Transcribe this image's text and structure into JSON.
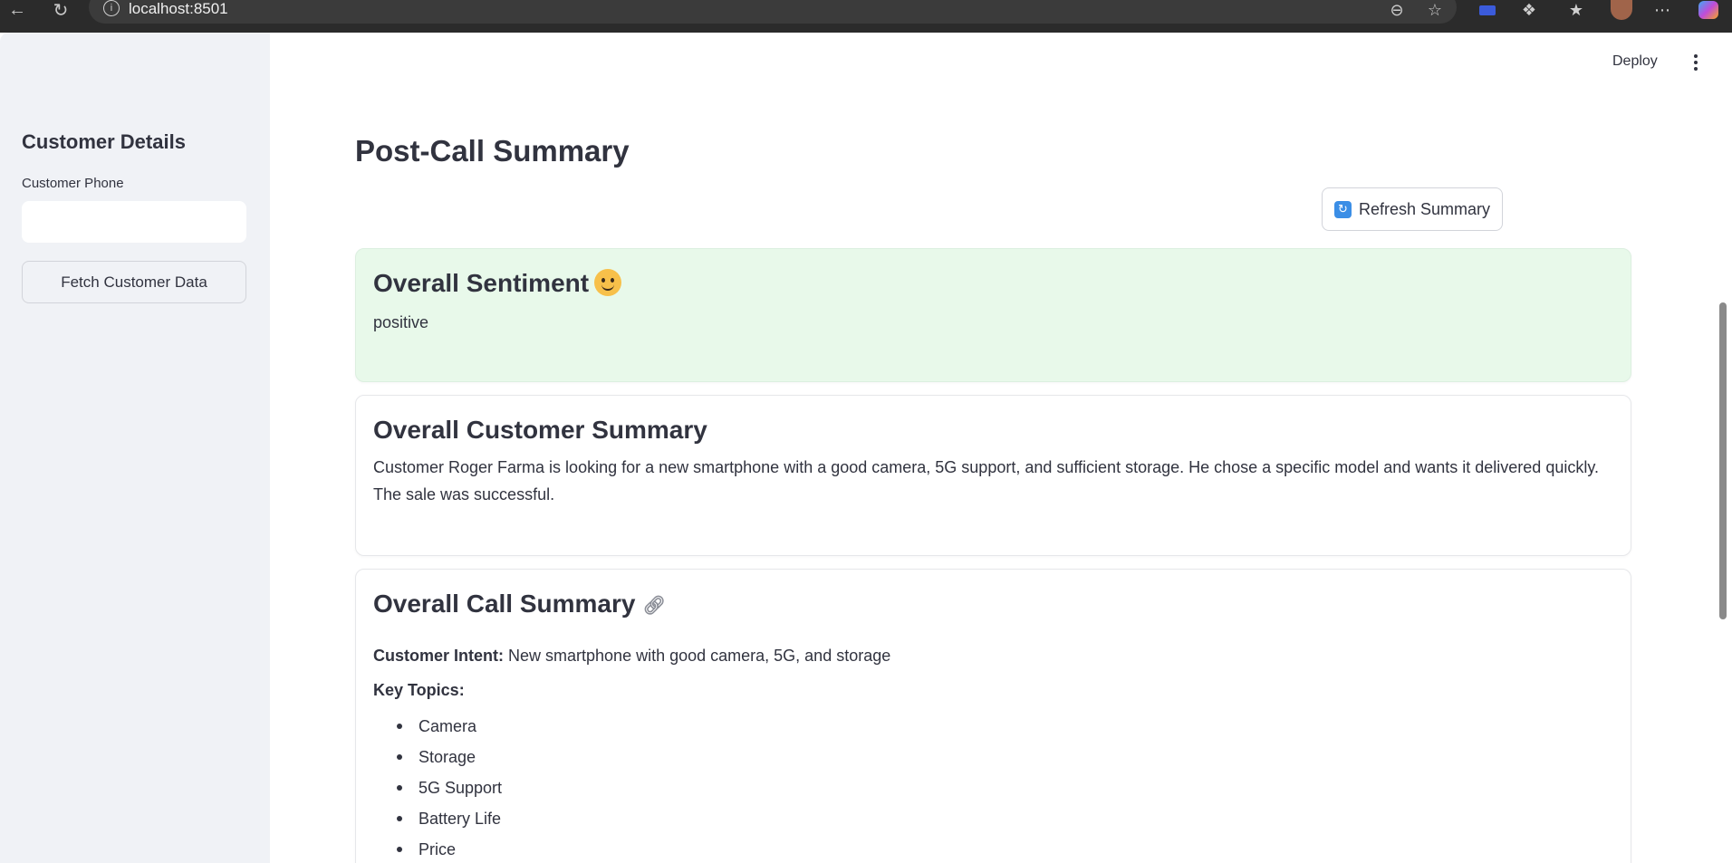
{
  "browser": {
    "url": "localhost:8501",
    "icons": [
      "back-icon",
      "reload-icon",
      "info-icon",
      "zoom-out-icon",
      "star-icon",
      "screen-icon",
      "extensions-icon",
      "favorites-icon",
      "profile-icon",
      "more-icon",
      "copilot-icon"
    ]
  },
  "header": {
    "deploy_label": "Deploy"
  },
  "sidebar": {
    "title": "Customer Details",
    "phone_label": "Customer Phone",
    "phone_value": "",
    "fetch_button": "Fetch Customer Data"
  },
  "main": {
    "title": "Post-Call Summary",
    "refresh_button": "Refresh Summary",
    "sentiment": {
      "title": "Overall Sentiment",
      "value": "positive"
    },
    "customer_summary": {
      "title": "Overall Customer Summary",
      "text": "Customer Roger Farma is looking for a new smartphone with a good camera, 5G support, and sufficient storage. He chose a specific model and wants it delivered quickly. The sale was successful."
    },
    "call_summary": {
      "title": "Overall Call Summary",
      "intent_label": "Customer Intent:",
      "intent_value": "New smartphone with good camera, 5G, and storage",
      "topics_label": "Key Topics:",
      "topics": [
        "Camera",
        "Storage",
        "5G Support",
        "Battery Life",
        "Price"
      ]
    }
  },
  "colors": {
    "sidebar_bg": "#f0f2f6",
    "sentiment_bg": "#e8f9ea",
    "text": "#31333f"
  }
}
